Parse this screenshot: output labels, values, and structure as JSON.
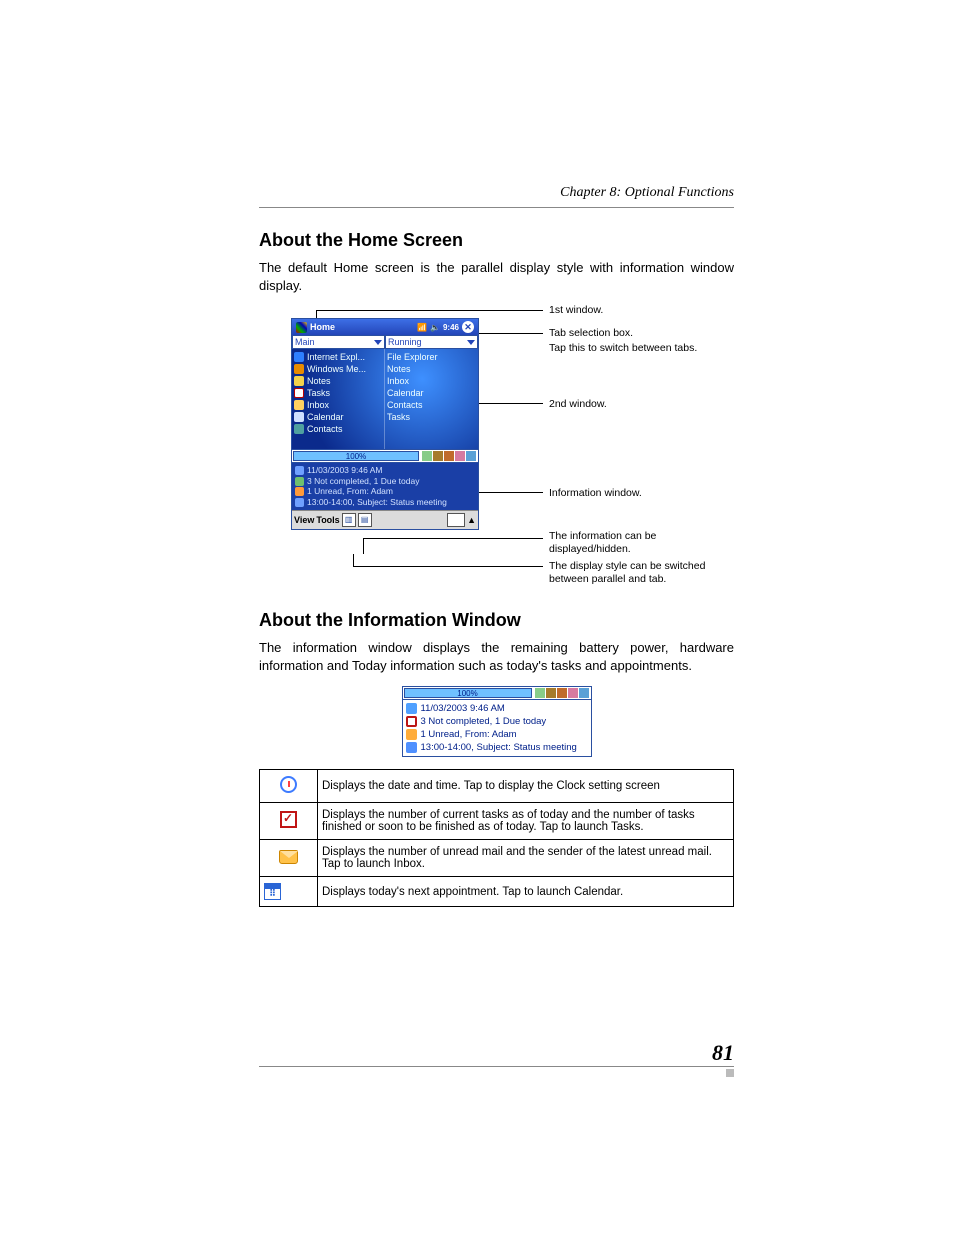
{
  "chapter_header": "Chapter 8: Optional Functions",
  "section1_title": "About the Home Screen",
  "section1_body": "The default Home screen is the parallel display style with information window display.",
  "device": {
    "title": "Home",
    "time": "9:46",
    "tab_left": "Main",
    "tab_right": "Running",
    "left_items": [
      {
        "icon": "ic-e",
        "label": "Internet Expl..."
      },
      {
        "icon": "ic-w",
        "label": "Windows Me..."
      },
      {
        "icon": "ic-n",
        "label": "Notes"
      },
      {
        "icon": "ic-t",
        "label": "Tasks"
      },
      {
        "icon": "ic-i",
        "label": "Inbox"
      },
      {
        "icon": "ic-c",
        "label": "Calendar"
      },
      {
        "icon": "ic-ct",
        "label": "Contacts"
      }
    ],
    "right_items": [
      {
        "label": "File Explorer"
      },
      {
        "label": "Notes"
      },
      {
        "label": "Inbox"
      },
      {
        "label": "Calendar"
      },
      {
        "label": "Contacts"
      },
      {
        "label": "Tasks"
      }
    ],
    "battery_pct": "100%",
    "info_lines": {
      "datetime": "11/03/2003 9:46 AM",
      "tasks": "3 Not completed, 1 Due today",
      "mail": "1 Unread, From: Adam",
      "cal": "13:00-14:00, Subject: Status meeting"
    },
    "bottombar": {
      "view": "View",
      "tools": "Tools"
    }
  },
  "callouts": {
    "c1": "1st window.",
    "c2a": "Tab selection box.",
    "c2b": "Tap this to switch between tabs.",
    "c3": "2nd window.",
    "c4": "Information window.",
    "c5": "The information can be displayed/hidden.",
    "c6": "The display style can be switched between parallel and tab."
  },
  "section2_title": "About the Information Window",
  "section2_body": "The information window displays the remaining battery power, hardware information and Today information such as today's tasks and appointments.",
  "info_window": {
    "battery_pct": "100%",
    "datetime": "11/03/2003 9:46 AM",
    "tasks": "3 Not completed, 1 Due today",
    "mail": "1 Unread, From: Adam",
    "cal": "13:00-14:00, Subject: Status meeting"
  },
  "icon_table": [
    {
      "icon": "clock",
      "desc": "Displays the date and time. Tap to display the Clock setting screen"
    },
    {
      "icon": "task",
      "desc": "Displays the number of current tasks as of today and the number of tasks finished or soon to be finished as of today. Tap to launch Tasks."
    },
    {
      "icon": "mail",
      "desc": "Displays the number of unread mail and the sender of the latest unread mail. Tap to launch Inbox."
    },
    {
      "icon": "cal",
      "desc": "Displays today's next appointment. Tap to launch Calendar."
    }
  ],
  "page_number": "81"
}
